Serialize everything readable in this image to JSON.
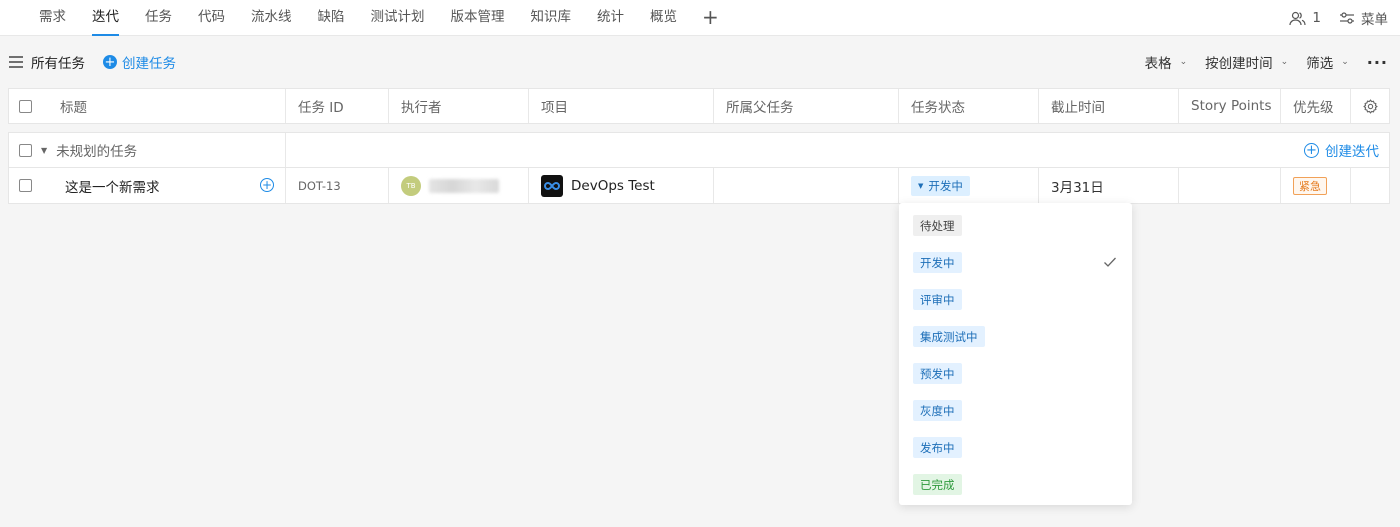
{
  "nav": {
    "tabs": [
      "需求",
      "迭代",
      "任务",
      "代码",
      "流水线",
      "缺陷",
      "测试计划",
      "版本管理",
      "知识库",
      "统计",
      "概览"
    ],
    "active_tab": "迭代",
    "add_label": "+",
    "members_count": "1",
    "menu_label": "菜单"
  },
  "toolbar": {
    "all_tasks_label": "所有任务",
    "create_task_label": "创建任务",
    "view_label": "表格",
    "sort_label": "按创建时间",
    "filter_label": "筛选",
    "more_label": "···"
  },
  "table": {
    "columns": {
      "title": "标题",
      "task_id": "任务 ID",
      "assignee": "执行者",
      "project": "项目",
      "parent": "所属父任务",
      "status": "任务状态",
      "due": "截止时间",
      "story_points": "Story Points",
      "priority": "优先级"
    },
    "group": {
      "name": "未规划的任务",
      "create_iteration_label": "创建迭代"
    },
    "rows": [
      {
        "title": "这是一个新需求",
        "task_id": "DOT-13",
        "assignee_initials": "TB",
        "project": "DevOps Test",
        "parent": "",
        "status": "开发中",
        "due": "3月31日",
        "story_points": "",
        "priority": "紧急"
      }
    ]
  },
  "status_dropdown": {
    "options": [
      {
        "label": "待处理",
        "style": "gray"
      },
      {
        "label": "开发中",
        "style": "blue",
        "selected": true
      },
      {
        "label": "评审中",
        "style": "blue"
      },
      {
        "label": "集成测试中",
        "style": "blue"
      },
      {
        "label": "预发中",
        "style": "blue"
      },
      {
        "label": "灰度中",
        "style": "blue"
      },
      {
        "label": "发布中",
        "style": "blue"
      },
      {
        "label": "已完成",
        "style": "green"
      }
    ]
  },
  "colors": {
    "accent": "#1e8be6",
    "status_blue_bg": "#dcefff",
    "priority_urgent": "#e57b1f",
    "done_green": "#2e9a3c"
  }
}
